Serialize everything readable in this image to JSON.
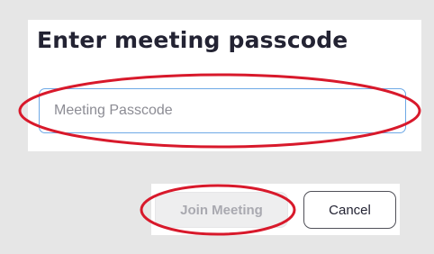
{
  "dialog": {
    "title": "Enter meeting passcode",
    "passcode_field": {
      "value": "",
      "placeholder": "Meeting Passcode"
    },
    "join_button_label": "Join Meeting",
    "join_button_state": "disabled",
    "cancel_button_label": "Cancel"
  },
  "annotations": {
    "highlight_color": "#d8192b",
    "circled": [
      "passcode-input",
      "join-meeting-button"
    ]
  },
  "colors": {
    "field_border": "#6ea9e6",
    "title_text": "#232333",
    "disabled_text": "#a9a9b0"
  }
}
